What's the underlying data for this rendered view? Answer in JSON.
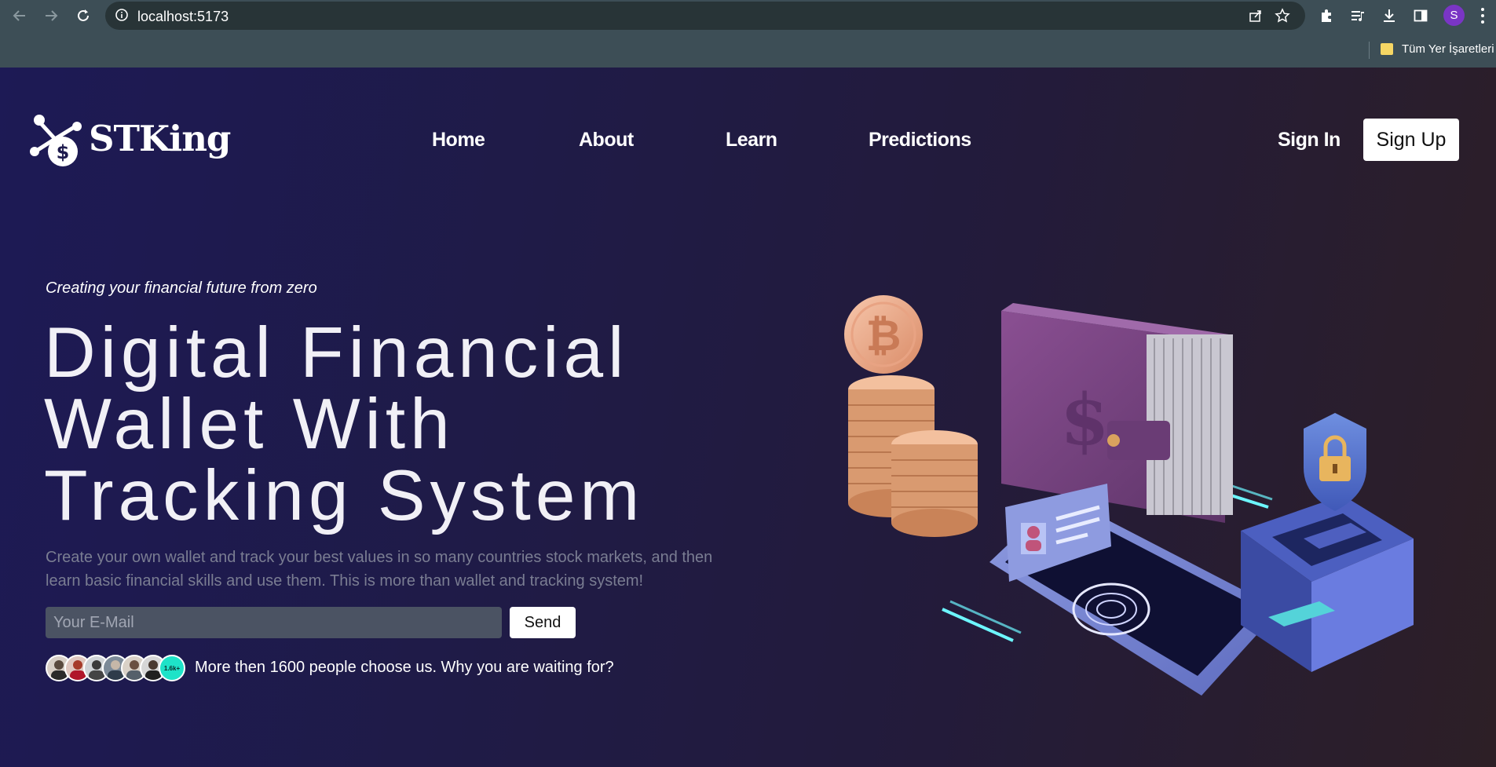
{
  "browser": {
    "url": "localhost:5173",
    "profile_initial": "S",
    "bookmarks_label": "Tüm Yer İşaretleri"
  },
  "brand": {
    "name": "STKing"
  },
  "nav": {
    "items": [
      {
        "label": "Home"
      },
      {
        "label": "About"
      },
      {
        "label": "Learn"
      },
      {
        "label": "Predictions"
      }
    ],
    "signin_label": "Sign In",
    "signup_label": "Sign Up"
  },
  "hero": {
    "tagline": "Creating your financial future from zero",
    "headline_lines": [
      "Digital Financial",
      "Wallet With",
      "Tracking System"
    ],
    "description": "Create your own wallet and track your best values in so many countries stock markets, and then learn basic financial skills and use them. This is more than wallet and tracking system!",
    "email_placeholder": "Your E-Mail",
    "send_label": "Send",
    "avatar_count_badge": "1.6k+",
    "social_proof": "More then 1600 people choose us. Why you are waiting for?"
  },
  "colors": {
    "signup_bg": "#ffffff",
    "count_badge": "#1ee3c8"
  }
}
